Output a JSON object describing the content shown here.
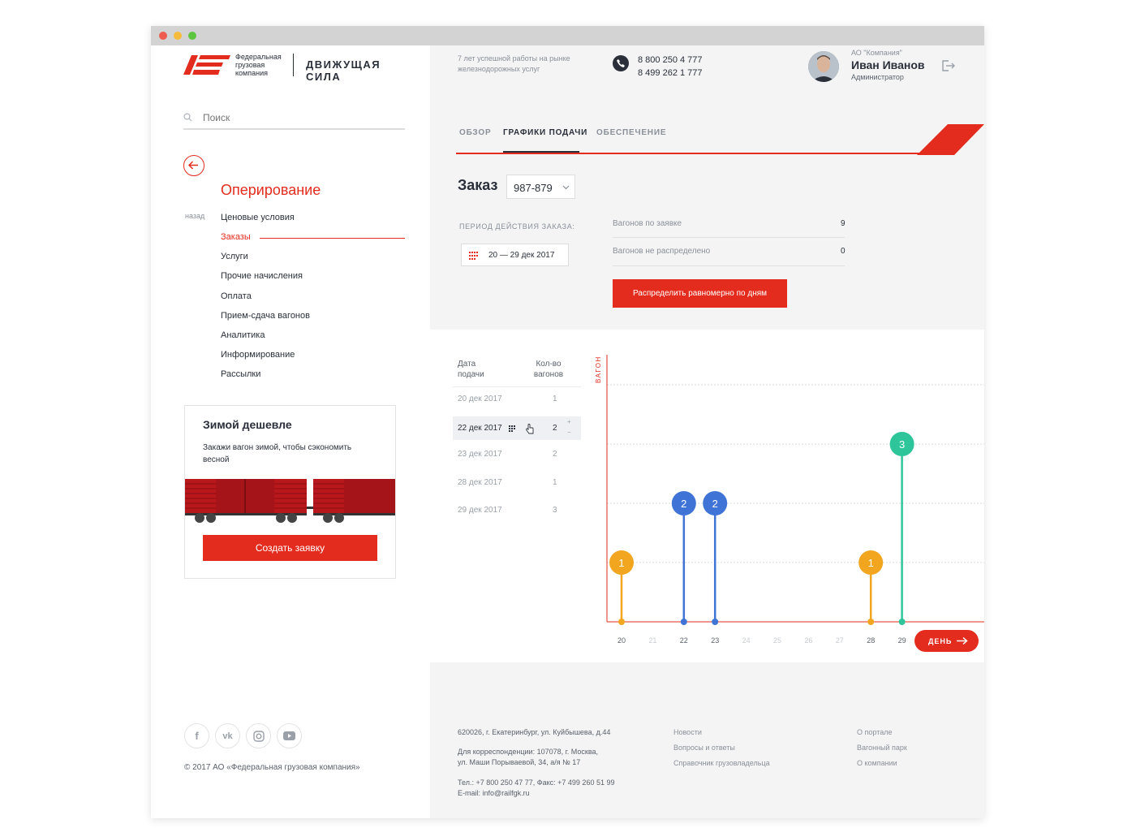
{
  "logo": {
    "line1": "Федеральная",
    "line2": "грузовая",
    "line3": "компания",
    "brand": "ДВИЖУЩАЯ СИЛА"
  },
  "search": {
    "placeholder": "Поиск"
  },
  "nav": {
    "back_label": "назад",
    "section_title": "Оперирование",
    "items": [
      {
        "label": "Ценовые условия"
      },
      {
        "label": "Заказы"
      },
      {
        "label": "Услуги"
      },
      {
        "label": "Прочие начисления"
      },
      {
        "label": "Оплата"
      },
      {
        "label": "Прием-сдача вагонов"
      },
      {
        "label": "Аналитика"
      },
      {
        "label": "Информирование"
      },
      {
        "label": "Рассылки"
      }
    ]
  },
  "promo": {
    "title": "Зимой дешевле",
    "text_line1": "Закажи вагон зимой, чтобы сэкономить",
    "text_line2": "весной",
    "button": "Создать заявку"
  },
  "social": {
    "icons": [
      "facebook-icon",
      "vk-icon",
      "instagram-icon",
      "youtube-icon"
    ]
  },
  "copyright": "© 2017 АО «Федеральная грузовая компания»",
  "header": {
    "tagline_line1": "7 лет успешной работы на рынке",
    "tagline_line2": "железнодорожных услуг",
    "phone1": "8 800 250 4 777",
    "phone2": "8 499 262 1 777",
    "company": "АО \"Компания\"",
    "user_name": "Иван Иванов",
    "user_role": "Администратор"
  },
  "tabs": [
    {
      "label": "ОБЗОР"
    },
    {
      "label": "ГРАФИКИ ПОДАЧИ"
    },
    {
      "label": "ОБЕСПЕЧЕНИЕ"
    }
  ],
  "order": {
    "label": "Заказ",
    "number": "987-879",
    "period_label": "ПЕРИОД ДЕЙСТВИЯ ЗАКАЗА:",
    "period_value": "20 — 29 дек 2017",
    "stats": [
      {
        "label": "Вагонов по заявке",
        "value": "9"
      },
      {
        "label": "Вагонов не распределено",
        "value": "0"
      }
    ],
    "distribute_button": "Распределить равномерно по дням"
  },
  "schedule_table": {
    "col_date_line1": "Дата",
    "col_date_line2": "подачи",
    "col_count_line1": "Кол-во",
    "col_count_line2": "вагонов",
    "rows": [
      {
        "date": "20 дек 2017",
        "count": "1"
      },
      {
        "date": "22 дек 2017",
        "count": "2"
      },
      {
        "date": "23 дек 2017",
        "count": "2"
      },
      {
        "date": "28 дек 2017",
        "count": "1"
      },
      {
        "date": "29 дек 2017",
        "count": "3"
      }
    ],
    "stepper_plus": "+",
    "stepper_minus": "−"
  },
  "chart_data": {
    "type": "scatter",
    "ylabel": "ВАГОН",
    "xlabel": "",
    "x_ticks": [
      "20",
      "21",
      "22",
      "23",
      "24",
      "25",
      "26",
      "27",
      "28",
      "29"
    ],
    "active_ticks": [
      "20",
      "22",
      "23",
      "28",
      "29"
    ],
    "ylim": [
      0,
      4
    ],
    "points": [
      {
        "x": "20",
        "y": 1,
        "color": "#f2a51e"
      },
      {
        "x": "22",
        "y": 2,
        "color": "#3f74d6"
      },
      {
        "x": "23",
        "y": 2,
        "color": "#3f74d6"
      },
      {
        "x": "28",
        "y": 1,
        "color": "#f2a51e"
      },
      {
        "x": "29",
        "y": 3,
        "color": "#2ec59a"
      }
    ],
    "scale_button": "ДЕНЬ",
    "grid": true
  },
  "footer": {
    "address": "620026, г. Екатеринбург, ул. Куйбышева, д.44",
    "corr_line1": "Для корреспонденции: 107078, г. Москва,",
    "corr_line2": "ул. Маши Порываевой, 34, а/я № 17",
    "contacts_line1": "Тел.: +7 800 250 47 77, Факс: +7 499 260 51 99",
    "contacts_line2": "E-mail: info@railfgk.ru",
    "links_col1": [
      "Новости",
      "Вопросы и ответы",
      "Справочник грузовладельца"
    ],
    "links_col2": [
      "О портале",
      "Вагонный парк",
      "О компании"
    ]
  },
  "colors": {
    "accent": "#e32c1e",
    "orange": "#f2a51e",
    "blue": "#3f74d6",
    "green": "#2ec59a"
  }
}
